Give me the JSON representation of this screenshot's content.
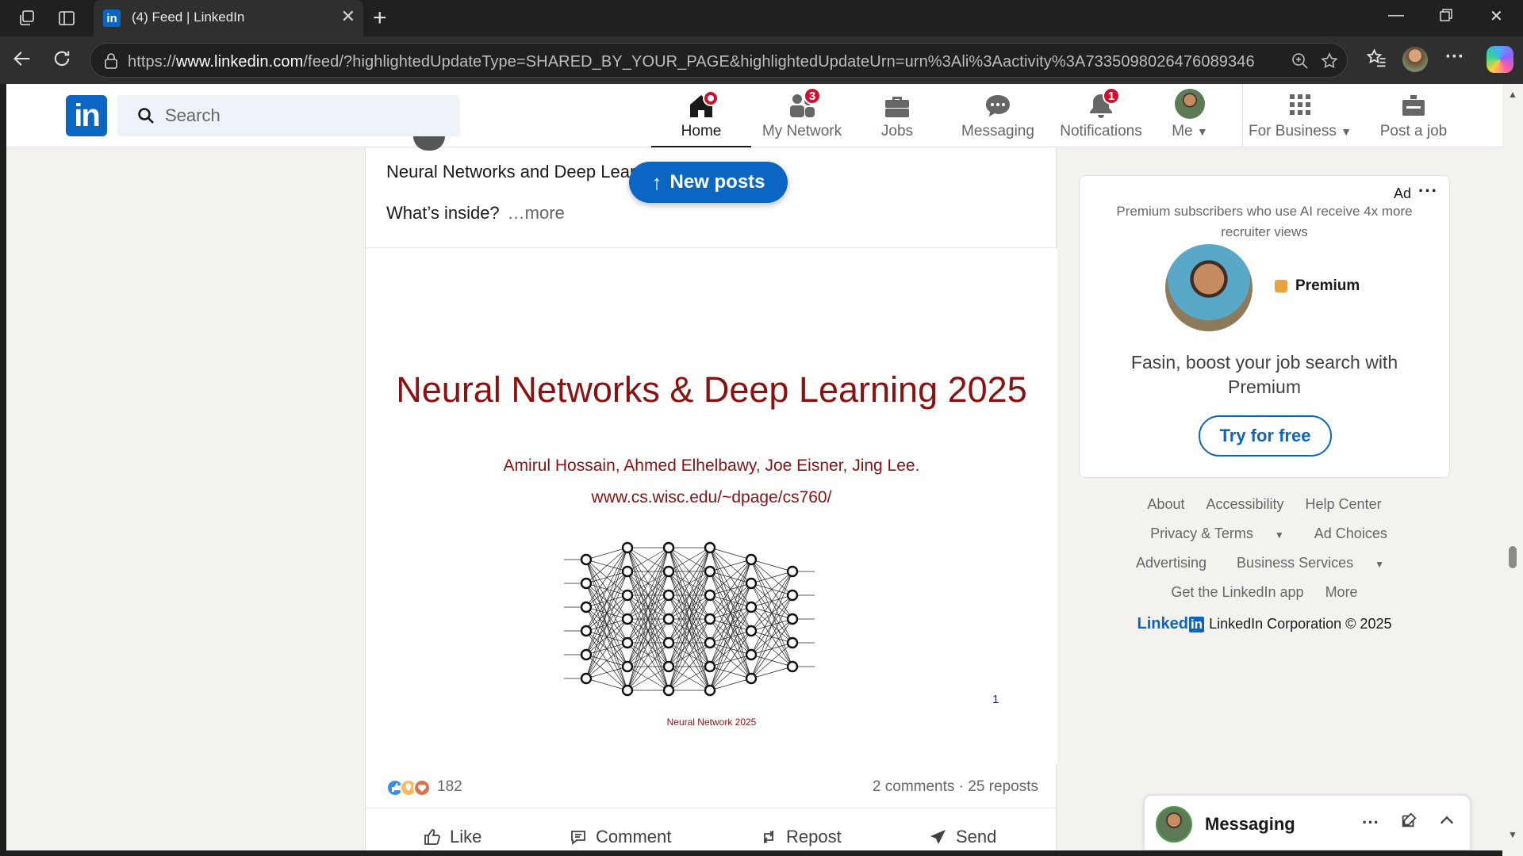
{
  "browser": {
    "tab_title": "(4) Feed | LinkedIn",
    "tab_favicon": "in",
    "new_tab_label": "+",
    "url_prefix": "https://",
    "url_host": "www.linkedin.com",
    "url_path": "/feed/?highlightedUpdateType=SHARED_BY_YOUR_PAGE&highlightedUpdateUrn=urn%3Ali%3Aactivity%3A7335098026476089346",
    "icons": [
      "workspaces-icon",
      "tab-actions-icon",
      "back-icon",
      "refresh-icon",
      "site-info-icon",
      "zoom-icon",
      "favorite-icon",
      "favorites-icon",
      "more-icon",
      "copilot-icon"
    ]
  },
  "linkedin": {
    "logo": "in",
    "search_placeholder": "Search",
    "nav": {
      "home": "Home",
      "network": "My Network",
      "network_badge": "3",
      "jobs": "Jobs",
      "messaging": "Messaging",
      "notifications": "Notifications",
      "notifications_badge": "1",
      "me": "Me",
      "business": "For Business",
      "post_job": "Post a job"
    },
    "colors": {
      "brand": "#0a66c2",
      "badge": "#cb112d",
      "slide_text": "#8b1010"
    }
  },
  "post": {
    "text_line": "Neural Networks and Deep Lear",
    "whats_inside": "What’s inside?",
    "more": "…more",
    "new_posts_label": "New posts",
    "slide": {
      "title": "Neural Networks & Deep Learning 2025",
      "authors": "Amirul Hossain, Ahmed Elhelbawy, Joe Eisner, Jing Lee.",
      "url": "www.cs.wisc.edu/~dpage/cs760/",
      "caption": "Neural Network 2025",
      "page": "1"
    },
    "reactions_count": "182",
    "comments_reposts": "2 comments · 25 reposts",
    "actions": {
      "like": "Like",
      "comment": "Comment",
      "repost": "Repost",
      "send": "Send"
    }
  },
  "ad": {
    "label": "Ad",
    "text": "Premium subscribers who use AI receive 4x more recruiter views",
    "premium": "Premium",
    "headline": "Fasin, boost your job search with Premium",
    "cta": "Try for free"
  },
  "footer": {
    "row1": [
      "About",
      "Accessibility",
      "Help Center"
    ],
    "row2": [
      "Privacy & Terms",
      "Ad Choices"
    ],
    "row3": [
      "Advertising",
      "Business Services"
    ],
    "row4": [
      "Get the LinkedIn app",
      "More"
    ],
    "brand": "Linked",
    "brand_in": "in",
    "copyright": "LinkedIn Corporation © 2025"
  },
  "messaging": {
    "title": "Messaging"
  }
}
